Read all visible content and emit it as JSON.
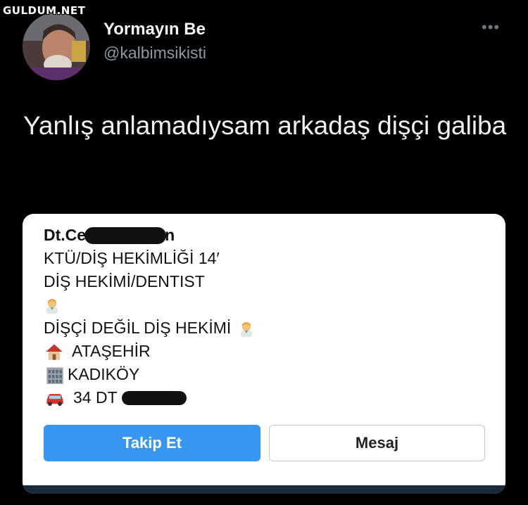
{
  "watermark": "GULDUM.NET",
  "user": {
    "display_name": "Yormayın Be",
    "handle": "@kalbimsikisti"
  },
  "tweet": {
    "text": "Yanlış anlamadıysam arkadaş dişçi galiba"
  },
  "embedded_profile": {
    "name_prefix": "Dt.Ce",
    "name_suffix": "n",
    "bio_lines": [
      "KTÜ/DİŞ HEKİMLİĞİ 14′",
      "DİŞ HEKİMİ/DENTIST",
      "DİŞÇİ DEĞİL DİŞ HEKİMİ",
      "ATAŞEHİR",
      "KADIKÖY",
      "34 DT"
    ],
    "icons": [
      "dentist-emoji",
      "house-emoji",
      "office-building-emoji",
      "car-emoji"
    ],
    "follow_label": "Takip Et",
    "message_label": "Mesaj",
    "accent_color": "#3797f0"
  }
}
